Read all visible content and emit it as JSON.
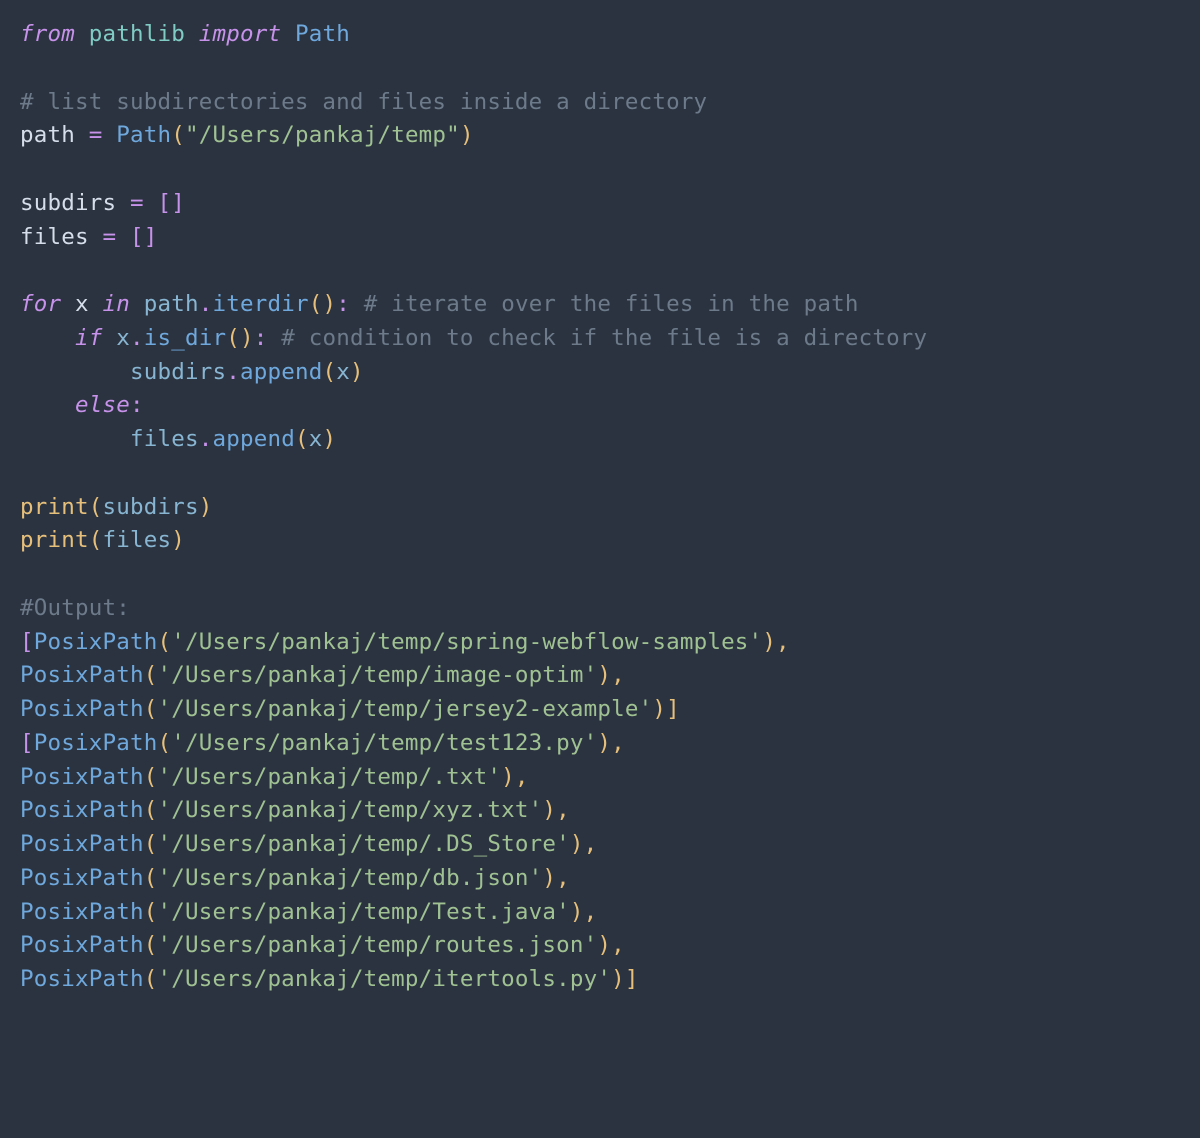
{
  "code": {
    "t": {
      "from": "from",
      "import": "import",
      "pathlib": "pathlib",
      "PathCls": "Path",
      "comment_list": "# list subdirectories and files inside a directory",
      "path_assign_lhs": "path",
      "eq": "=",
      "path_str": "\"/Users/pankaj/temp\"",
      "subdirs": "subdirs",
      "files": "files",
      "empty_brackets": "[]",
      "for": "for",
      "x": "x",
      "in": "in",
      "dot": ".",
      "iterdir": "iterdir",
      "parens": "()",
      "colon": ":",
      "comment_iter": "# iterate over the files in the path",
      "if": "if",
      "is_dir": "is_dir",
      "comment_cond": "# condition to check if the file is a directory",
      "append": "append",
      "lparen": "(",
      "rparen": ")",
      "else": "else",
      "print": "print",
      "comment_output": "#Output:",
      "lbracket": "[",
      "rbracket": "]",
      "PosixPath": "PosixPath",
      "comma": ",",
      "sep": "), ",
      "end": ")]"
    },
    "output": {
      "subdirs": [
        "'/Users/pankaj/temp/spring-webflow-samples'",
        "'/Users/pankaj/temp/image-optim'",
        "'/Users/pankaj/temp/jersey2-example'"
      ],
      "files": [
        "'/Users/pankaj/temp/test123.py'",
        "'/Users/pankaj/temp/.txt'",
        "'/Users/pankaj/temp/xyz.txt'",
        "'/Users/pankaj/temp/.DS_Store'",
        "'/Users/pankaj/temp/db.json'",
        "'/Users/pankaj/temp/Test.java'",
        "'/Users/pankaj/temp/routes.json'",
        "'/Users/pankaj/temp/itertools.py'"
      ]
    }
  }
}
